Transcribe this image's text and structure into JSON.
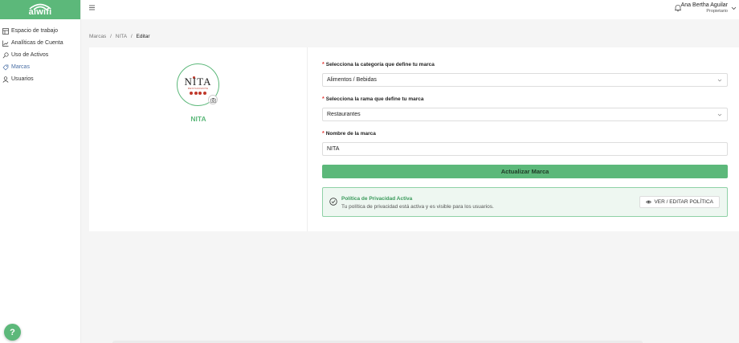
{
  "app": {
    "logo_text": "aiwifi"
  },
  "sidebar": {
    "items": [
      {
        "label": "Espacio de trabajo",
        "icon": "grid-icon",
        "active": false
      },
      {
        "label": "Analíticas de Cuenta",
        "icon": "chart-icon",
        "active": false
      },
      {
        "label": "Uso de Activos",
        "icon": "key-icon",
        "active": false
      },
      {
        "label": "Marcas",
        "icon": "tag-icon",
        "active": true
      },
      {
        "label": "Usuarios",
        "icon": "user-icon",
        "active": false
      }
    ],
    "help_label": "?"
  },
  "header": {
    "user_name": "Ana Bertha Aguilar",
    "user_role": "Propietario"
  },
  "breadcrumb": {
    "items": [
      "Marcas",
      "NITA",
      "Editar"
    ],
    "separator": "/"
  },
  "brand": {
    "logo_text": "NITA",
    "logo_subtext": "RESTAURANTE",
    "name": "NITA"
  },
  "form": {
    "category_label": "Selecciona la categoría que define tu marca",
    "category_value": "Alimentos / Bebidas",
    "branch_label": "Selecciona la rama que define tu marca",
    "branch_value": "Restaurantes",
    "name_label": "Nombre de la marca",
    "name_value": "NITA",
    "required_mark": "*",
    "submit_label": "Actualizar Marca"
  },
  "privacy": {
    "title": "Política de Privacidad Activa",
    "description": "Tu política de privacidad está activa y es visible para los usuarios.",
    "button_label": "VER / EDITAR POLÍTICA"
  },
  "colors": {
    "accent": "#5cb87a",
    "active_nav": "#4a6fa5",
    "required": "#e53935",
    "brand_red": "#c0392b"
  }
}
